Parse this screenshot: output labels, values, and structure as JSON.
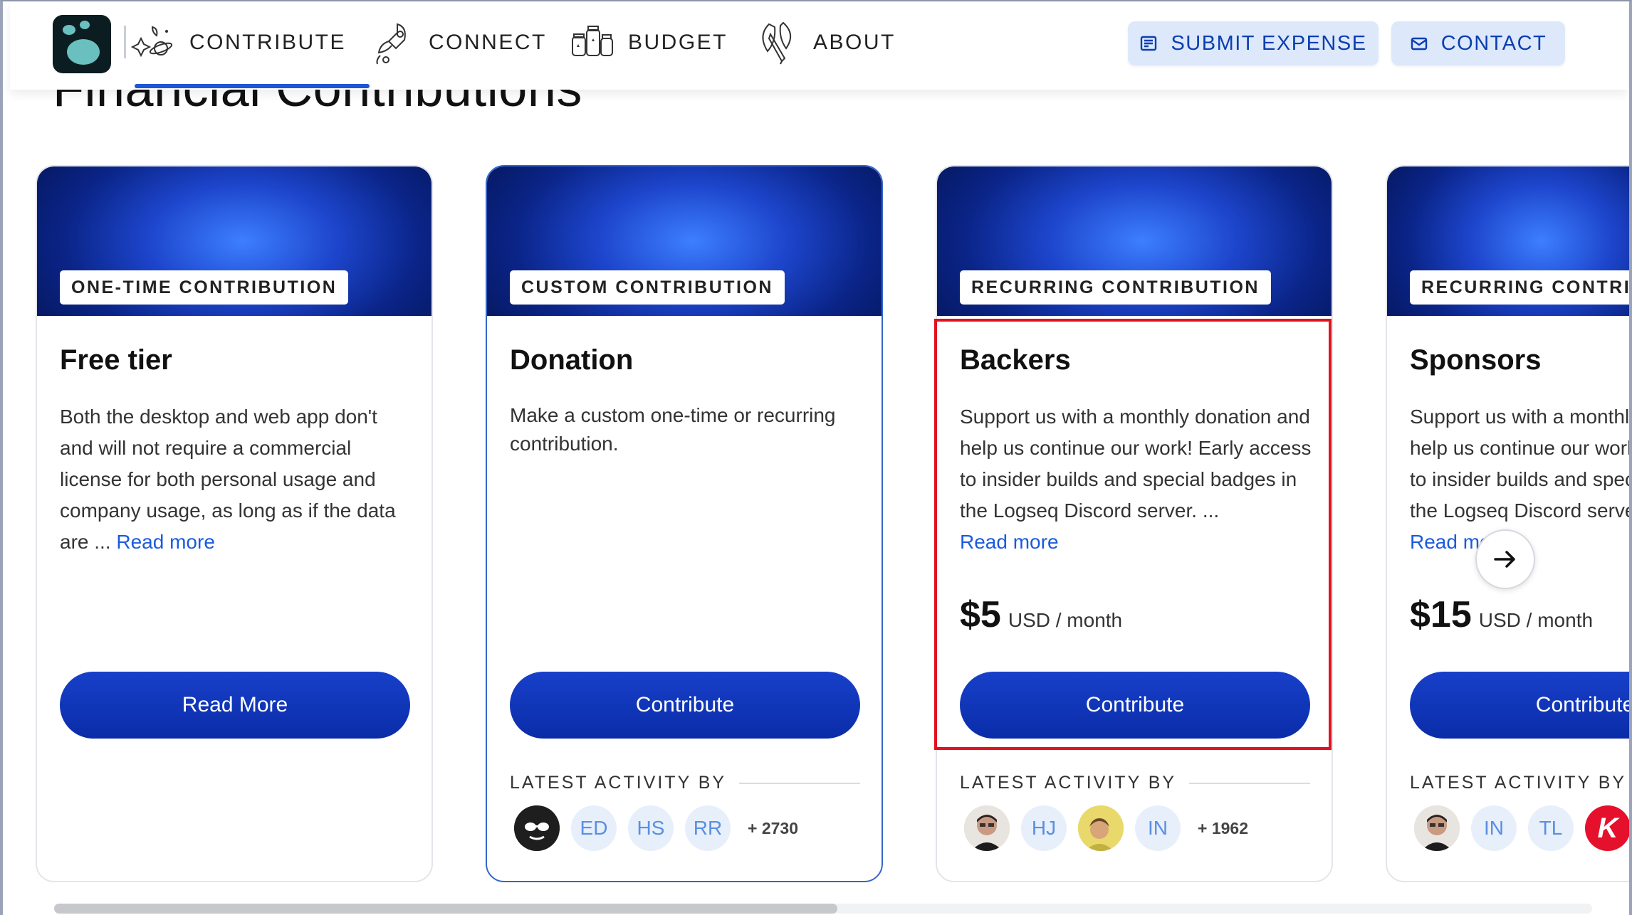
{
  "page": {
    "section_title": "Financial Contributions"
  },
  "nav": {
    "items": [
      {
        "label": "CONTRIBUTE",
        "icon": "sparkles-planet-icon"
      },
      {
        "label": "CONNECT",
        "icon": "rocket-icon"
      },
      {
        "label": "BUDGET",
        "icon": "jars-icon"
      },
      {
        "label": "ABOUT",
        "icon": "leaf-pen-icon"
      }
    ],
    "active": "CONTRIBUTE",
    "buttons": {
      "submit_expense": "SUBMIT EXPENSE",
      "contact": "CONTACT"
    }
  },
  "cards": [
    {
      "badge": "ONE-TIME CONTRIBUTION",
      "title": "Free tier",
      "description": "Both the desktop and web app don't and will not require a commercial license for both personal usage and company usage, as long as if the data are ...",
      "read_more": "Read more",
      "button": "Read More"
    },
    {
      "badge": "CUSTOM CONTRIBUTION",
      "title": "Donation",
      "description": "Make a custom one-time or recurring contribution.",
      "button": "Contribute",
      "activity_label": "LATEST ACTIVITY BY",
      "avatars": [
        "",
        "ED",
        "HS",
        "RR"
      ],
      "more_count": "+ 2730"
    },
    {
      "badge": "RECURRING CONTRIBUTION",
      "title": "Backers",
      "description": "Support us with a monthly donation and help us continue our work! Early access to insider builds and special badges in the Logseq Discord server. ...",
      "read_more": "Read more",
      "price": "$5",
      "period": "USD / month",
      "button": "Contribute",
      "activity_label": "LATEST ACTIVITY BY",
      "avatars": [
        "",
        "HJ",
        "",
        "IN"
      ],
      "more_count": "+ 1962"
    },
    {
      "badge": "RECURRING CONTRIBUTION",
      "title": "Sponsors",
      "description": "Support us with a monthly donation and help us continue our work! Early access to insider builds and special badges in the Logseq Discord server. ...",
      "read_more": "Read more",
      "price": "$15",
      "period": "USD / month",
      "button": "Contribute",
      "activity_label": "LATEST ACTIVITY BY",
      "avatars": [
        "",
        "IN",
        "TL",
        "K"
      ]
    }
  ],
  "colors": {
    "accent": "#1e56d6",
    "button": "#0a2ca8",
    "highlight_box": "#e0121f",
    "nav_button_bg": "#dde8fb"
  }
}
